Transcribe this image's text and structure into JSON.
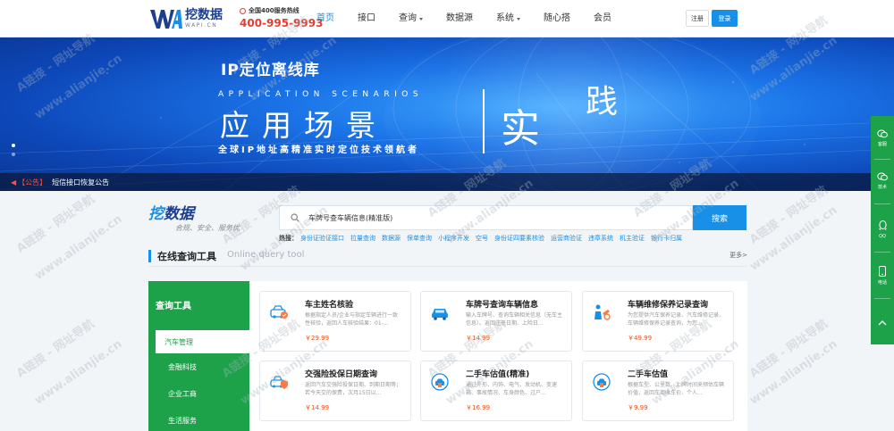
{
  "header": {
    "logo_name": "挖数据",
    "logo_sub": "WAPI.CN",
    "hotline_label": "全国400服务热线",
    "hotline_number": "400-995-9993",
    "nav": [
      {
        "label": "首页",
        "active": true
      },
      {
        "label": "接口"
      },
      {
        "label": "查询",
        "caret": true
      },
      {
        "label": "数据源"
      },
      {
        "label": "系统",
        "caret": true
      },
      {
        "label": "随心搭"
      },
      {
        "label": "会员"
      }
    ],
    "register": "注册",
    "login": "登录"
  },
  "banner": {
    "title": "IP定位离线库",
    "scenarios": "APPLICATION SCENARIOS",
    "big": "应用场景",
    "shijian": "实",
    "shijian2": "践",
    "slogan": "全球IP地址高精准实时定位技术领航者"
  },
  "notice": {
    "tag": "【公告】",
    "text": "短信接口恢复公告"
  },
  "search": {
    "logo_a": "挖",
    "logo_b": "数据",
    "slogan": "合规、安全、服务优",
    "value": "车牌号查车辆信息(精准版)",
    "button": "搜索",
    "hot_label": "热搜：",
    "hot": [
      "身份证验证接口",
      "拉量查询",
      "数据源",
      "保单查询",
      "小程序开发",
      "空号",
      "身份证四要素核验",
      "运营商验证",
      "违章系统",
      "机主验证",
      "银行卡归属"
    ]
  },
  "section": {
    "title": "在线查询工具",
    "sub": "Online query tool",
    "more": "更多>"
  },
  "tools": {
    "title": "查询工具",
    "items": [
      {
        "label": "汽车管理",
        "active": true
      },
      {
        "label": "金融科技"
      },
      {
        "label": "企业工商"
      },
      {
        "label": "生活服务"
      }
    ]
  },
  "cards": [
    {
      "title": "车主姓名核验",
      "desc": "根据指定人员/企业与指定车辆进行一致性核验，返回人车核验结果：01-...",
      "price": "￥29.99",
      "icon": "car-check-icon"
    },
    {
      "title": "车牌号查询车辆信息",
      "desc": "输入车牌号、查询车辆相关信息（无车主信息）。返回注册日期、上险日...",
      "price": "￥14.99",
      "icon": "car-icon"
    },
    {
      "title": "车辆维修保养记录查询",
      "desc": "为您提供汽车保养记录、汽车维修记录、车辆维修保养记录查询，为您...",
      "price": "￥49.99",
      "icon": "repair-icon"
    },
    {
      "title": "交强险投保日期查询",
      "desc": "返回汽车交强险投保日期、到期日期等；若今天交的保费，次月15日以...",
      "price": "￥14.99",
      "icon": "insurance-icon"
    },
    {
      "title": "二手车估值(精准)",
      "desc": "通过外形、内饰、电气、发动机、变速箱、事故情况、车身颜色、过户...",
      "price": "￥16.99",
      "icon": "car-value-icon"
    },
    {
      "title": "二手车估值",
      "desc": "根据车型、公里数、上牌时间来预估车辆价值，返回车商收车价、个人...",
      "price": "￥9.99",
      "icon": "car-value-icon"
    }
  ],
  "float": [
    {
      "label": "客服",
      "icon": "chat-icon"
    },
    {
      "label": "技术",
      "icon": "chat-icon"
    },
    {
      "label": "QQ",
      "icon": "qq-icon"
    },
    {
      "label": "电话",
      "icon": "phone-icon"
    }
  ],
  "watermark": "A链接 - 网址导航",
  "watermark_url": "www.alianjie.cn"
}
